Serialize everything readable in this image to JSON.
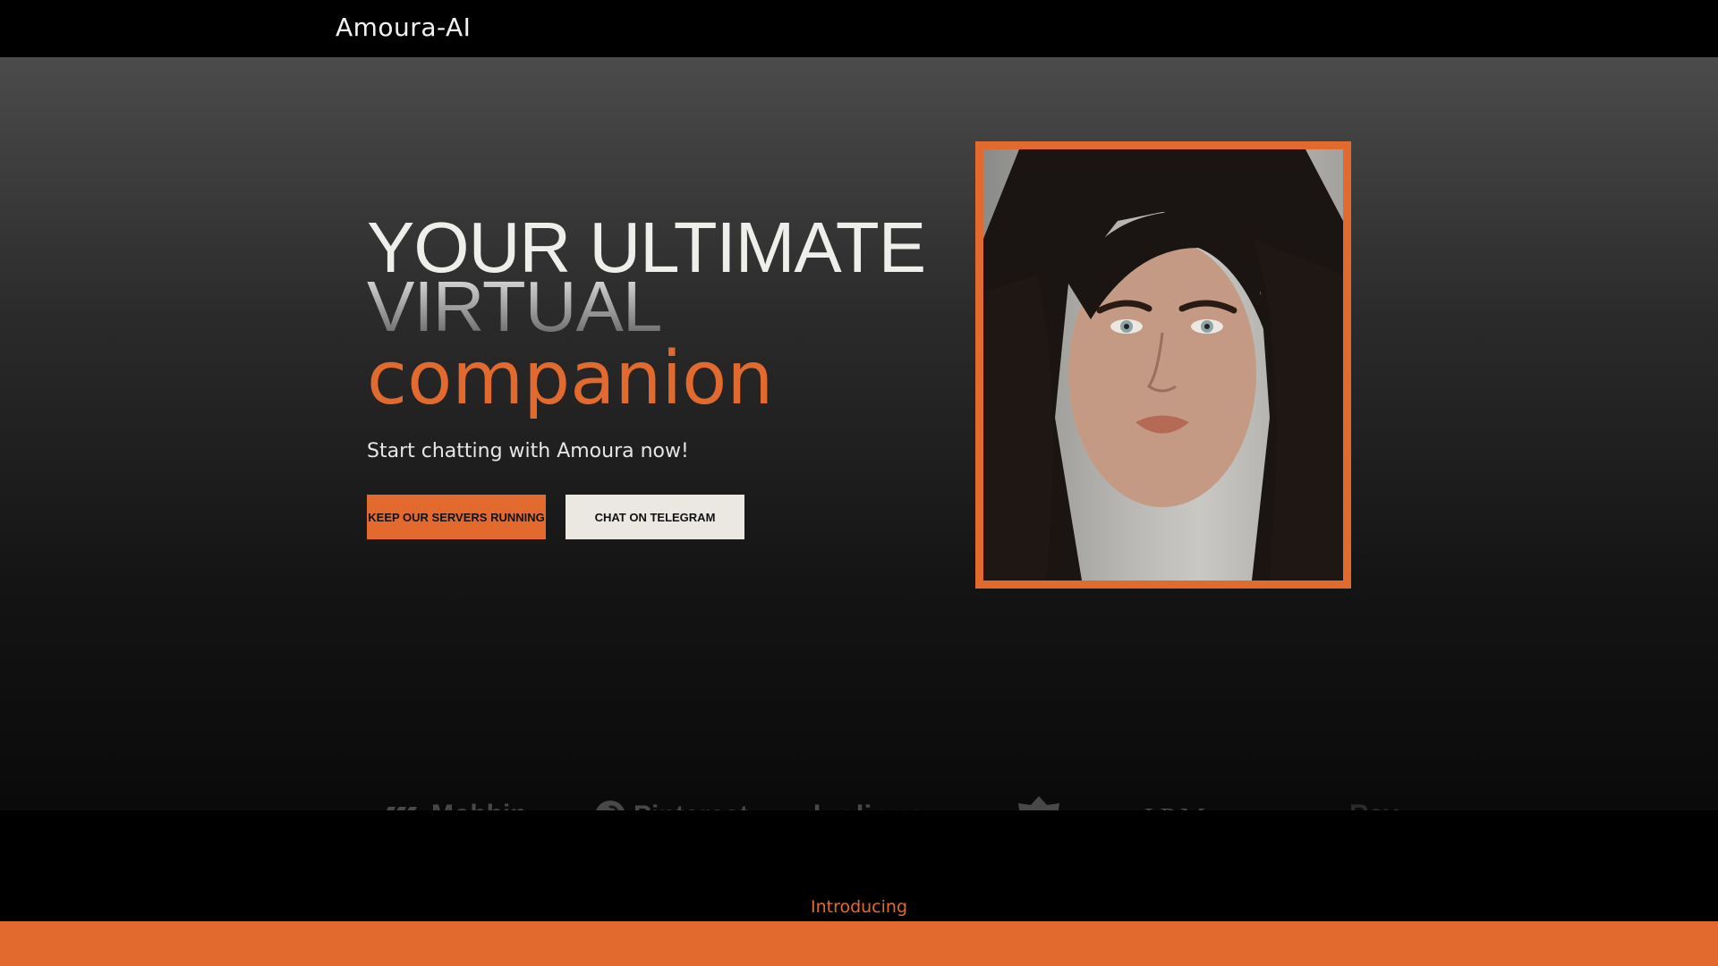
{
  "header": {
    "brand": "Amoura-AI"
  },
  "hero": {
    "headline_line1": "YOUR ULTIMATE",
    "headline_line2": "VIRTUAL",
    "headline_line3": "companion",
    "subtitle": "Start chatting with Amoura now!",
    "primary_button": "KEEP OUR SERVERS RUNNING",
    "secondary_button": "CHAT ON TELEGRAM"
  },
  "logos": [
    {
      "name": "Mobbin",
      "icon": "mobbin-logo-icon"
    },
    {
      "name": "Pinterest",
      "icon": "pinterest-logo-icon"
    },
    {
      "name": "duolingo",
      "icon": ""
    },
    {
      "name": "",
      "icon": "m-badge-logo-icon"
    },
    {
      "name": "J.P.Morgan",
      "icon": ""
    },
    {
      "name": "Rev",
      "icon": ""
    }
  ],
  "section": {
    "introducing": "Introducing"
  },
  "colors": {
    "accent": "#e36a2e",
    "background": "#000000",
    "secondary_button_bg": "#eae8e1"
  }
}
